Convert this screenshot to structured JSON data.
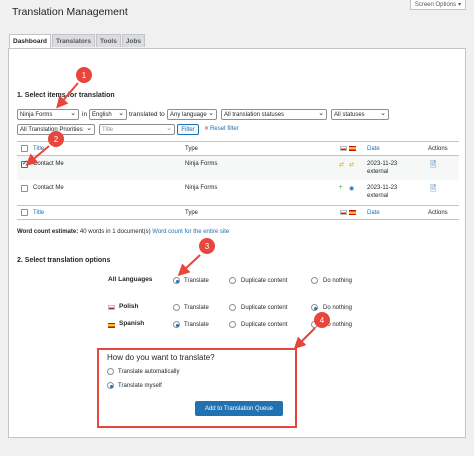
{
  "page_title": "Translation Management",
  "screen_options": "Screen Options",
  "tabs": [
    {
      "label": "Dashboard",
      "active": true
    },
    {
      "label": "Translators"
    },
    {
      "label": "Tools"
    },
    {
      "label": "Jobs"
    }
  ],
  "section1_title": "1. Select items for translation",
  "filters": {
    "plugin": "Ninja Forms",
    "in": "in",
    "language": "English",
    "translated_to": "translated to",
    "target_language": "Any language",
    "statuses1": "All translation statuses",
    "statuses2": "All statuses",
    "priorities": "All Translation Priorities",
    "title_placeholder": "Title",
    "filter_button": "Filter",
    "reset": "Reset filter"
  },
  "table": {
    "headers": {
      "title": "Title",
      "type": "Type",
      "date": "Date",
      "actions": "Actions"
    },
    "rows": [
      {
        "title": "Contact Me",
        "type": "Ninja Forms",
        "date": "2023-11-23",
        "source": "external",
        "checked": true
      },
      {
        "title": "Contact Me",
        "type": "Ninja Forms",
        "date": "2023-11-23",
        "source": "external",
        "checked": false
      }
    ]
  },
  "word_count": {
    "label": "Word count estimate:",
    "text": "40 words in 1 document(s)",
    "link": "Word count for the entire site"
  },
  "section2_title": "2. Select translation options",
  "languages": [
    {
      "name": "All Languages",
      "flag": "",
      "selected": "translate"
    },
    {
      "name": "Polish",
      "flag": "pl",
      "selected": "do_nothing"
    },
    {
      "name": "Spanish",
      "flag": "es",
      "selected": "translate"
    }
  ],
  "options": {
    "translate": "Translate",
    "duplicate": "Duplicate content",
    "do_nothing": "Do nothing"
  },
  "method": {
    "question": "How do you want to translate?",
    "auto": "Translate automatically",
    "myself": "Translate myself",
    "button": "Add to Translation Queue"
  },
  "callouts": [
    "1",
    "2",
    "3",
    "4"
  ],
  "colors": {
    "accent": "#2271b1",
    "callout": "#e8463c"
  }
}
